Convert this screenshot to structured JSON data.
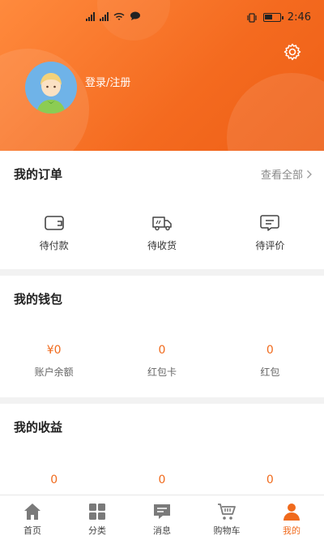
{
  "status_bar": {
    "time": "2:46"
  },
  "profile": {
    "login_text": "登录/注册"
  },
  "orders": {
    "title": "我的订单",
    "view_all": "查看全部",
    "items": [
      {
        "label": "待付款",
        "icon": "wallet-icon"
      },
      {
        "label": "待收货",
        "icon": "truck-icon"
      },
      {
        "label": "待评价",
        "icon": "comment-icon"
      }
    ]
  },
  "wallet": {
    "title": "我的钱包",
    "items": [
      {
        "value": "¥0",
        "label": "账户余额"
      },
      {
        "value": "0",
        "label": "红包卡"
      },
      {
        "value": "0",
        "label": "红包"
      }
    ]
  },
  "income": {
    "title": "我的收益",
    "items": [
      {
        "value": "0"
      },
      {
        "value": "0"
      },
      {
        "value": "0"
      }
    ]
  },
  "tabbar": {
    "items": [
      {
        "label": "首页",
        "icon": "home-icon"
      },
      {
        "label": "分类",
        "icon": "grid-icon"
      },
      {
        "label": "消息",
        "icon": "message-icon"
      },
      {
        "label": "购物车",
        "icon": "cart-icon"
      },
      {
        "label": "我的",
        "icon": "person-icon"
      }
    ],
    "active_index": 4
  },
  "colors": {
    "accent": "#f06a1c",
    "header_start": "#ff8a3d",
    "header_end": "#ee5f16"
  }
}
